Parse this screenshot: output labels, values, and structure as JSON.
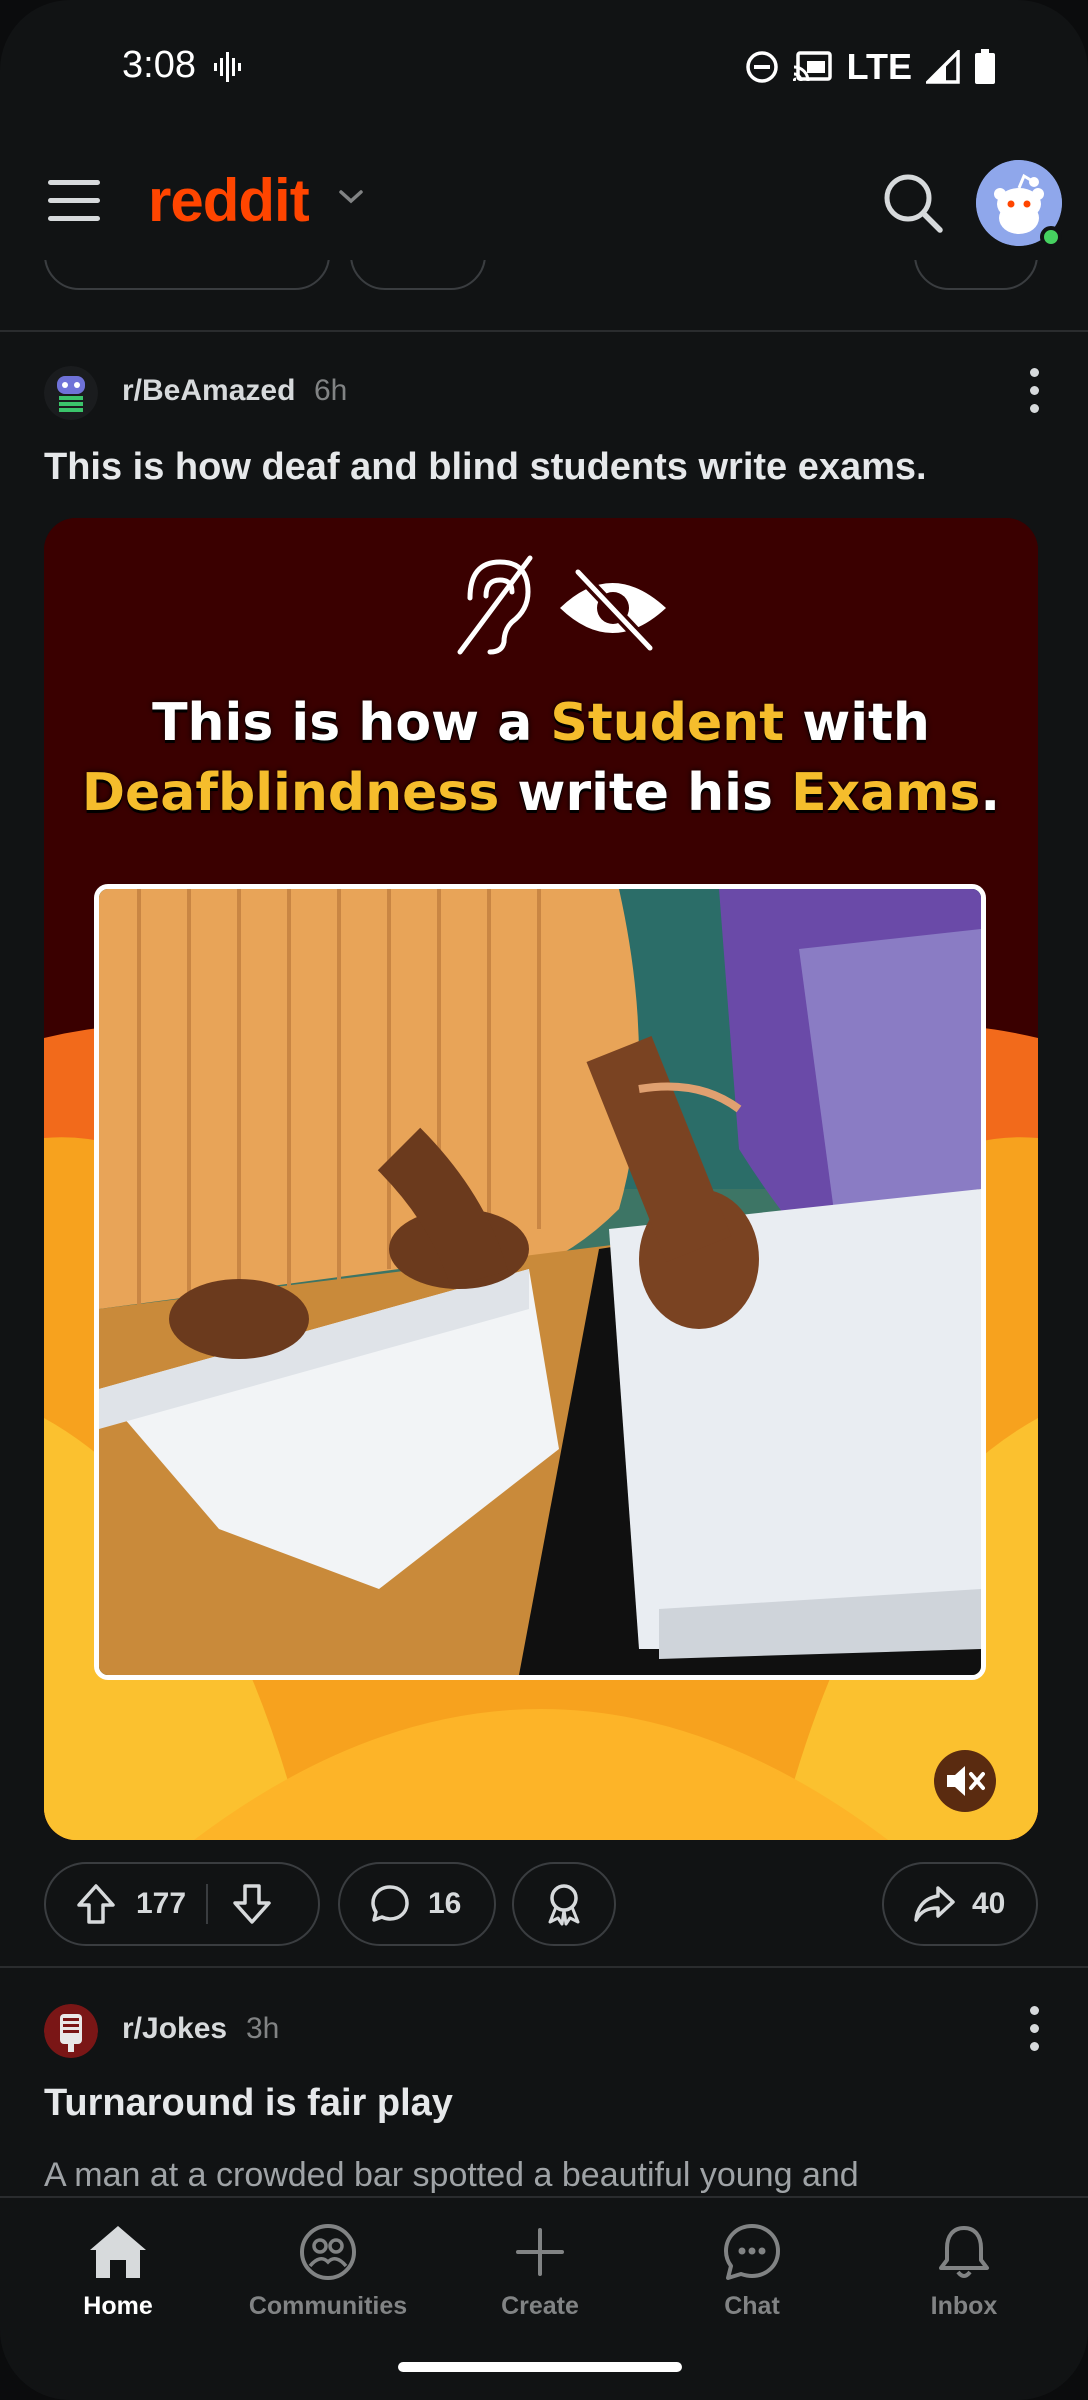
{
  "status_bar": {
    "time": "3:08",
    "network": "LTE"
  },
  "header": {
    "brand": "reddit"
  },
  "post": {
    "subreddit": "r/BeAmazed",
    "age": "6h",
    "title": "This is how deaf and blind students write exams.",
    "media_headline": {
      "part1": "This is how a ",
      "part2": "Student",
      "part3": " with",
      "part4": "Deafblindness",
      "part5": " write his ",
      "part6": "Exams",
      "part7": "."
    },
    "upvotes": "177",
    "comments": "16",
    "shares": "40"
  },
  "post2": {
    "subreddit": "r/Jokes",
    "age": "3h",
    "title": "Turnaround is fair play",
    "body_preview": "A man at a crowded bar spotted a beautiful young and"
  },
  "bottom_nav": {
    "items": [
      {
        "label": "Home",
        "icon": "home-icon",
        "active": true
      },
      {
        "label": "Communities",
        "icon": "communities-icon"
      },
      {
        "label": "Create",
        "icon": "plus-icon"
      },
      {
        "label": "Chat",
        "icon": "chat-icon"
      },
      {
        "label": "Inbox",
        "icon": "bell-icon"
      }
    ]
  },
  "colors": {
    "brand": "#ff4500",
    "highlight": "#f5bd2c",
    "media_bg": "#3a0000",
    "online": "#46d160"
  }
}
